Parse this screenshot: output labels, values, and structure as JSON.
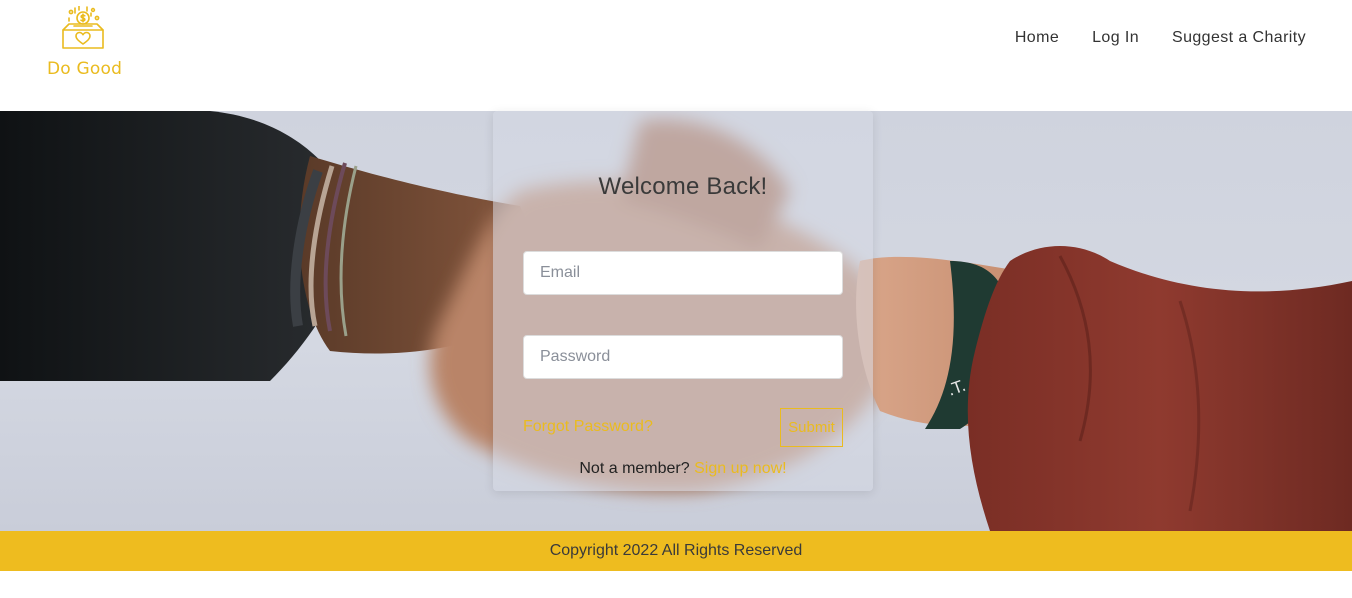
{
  "brand": {
    "name": "Do Good",
    "color": "#eabb1f"
  },
  "nav": {
    "items": [
      {
        "label": "Home"
      },
      {
        "label": "Log In"
      },
      {
        "label": "Suggest a Charity"
      }
    ]
  },
  "login": {
    "title": "Welcome Back!",
    "email_placeholder": "Email",
    "password_placeholder": "Password",
    "forgot_label": "Forgot Password?",
    "submit_label": "Submit",
    "signup_prompt": "Not a member?",
    "signup_link": "Sign up now!"
  },
  "footer": {
    "text": "Copyright 2022 All Rights Reserved",
    "color": "#eebc1f"
  },
  "icons": {
    "logo": "charity-box-heart-coin-icon"
  }
}
